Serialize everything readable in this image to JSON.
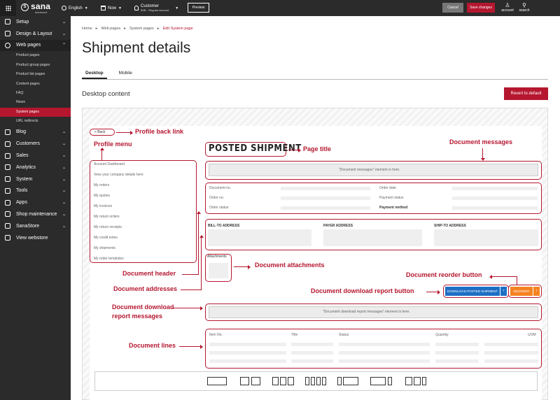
{
  "topbar": {
    "logo_word": "sana",
    "logo_sub": "advanced",
    "language": "English",
    "date": "Now",
    "customer_name": "Customer",
    "customer_sub": "B2B - Regular account",
    "preview": "Preview",
    "cancel": "Cancel",
    "save": "Save changes",
    "account": "account",
    "search": "search"
  },
  "sidebar": {
    "items": [
      {
        "label": "Setup"
      },
      {
        "label": "Design & Layout"
      },
      {
        "label": "Web pages"
      },
      {
        "label": "Blog"
      },
      {
        "label": "Customers"
      },
      {
        "label": "Sales"
      },
      {
        "label": "Analytics"
      },
      {
        "label": "System"
      },
      {
        "label": "Tools"
      },
      {
        "label": "Apps"
      },
      {
        "label": "Shop maintenance"
      },
      {
        "label": "SanaStore"
      },
      {
        "label": "View webstore"
      }
    ],
    "subitems": [
      "Product pages",
      "Product group pages",
      "Product list pages",
      "Content pages",
      "FAQ",
      "News",
      "System pages",
      "URL redirects"
    ]
  },
  "breadcrumb": [
    "Home",
    "Web pages",
    "System pages",
    "Edit System page"
  ],
  "page_title": "Shipment details",
  "tabs": [
    "Desktop",
    "Mobile"
  ],
  "section_title": "Desktop content",
  "revert_label": "Revert to default",
  "preview": {
    "back_label": "< Back",
    "page_title": "POSTED SHIPMENT",
    "profile_menu": [
      "Account Dashboard",
      "View your company details here",
      "My orders",
      "My quotes",
      "My invoices",
      "My return orders",
      "My return receipts",
      "My credit notes",
      "My shipments",
      "My order templates"
    ],
    "messages_placeholder": "\"Document messages\" element is here.",
    "header_fields_left": [
      "Document no.",
      "Order no.",
      "Order status"
    ],
    "header_fields_right": [
      "Order date",
      "Payment status",
      "Payment method"
    ],
    "addresses": [
      "BILL-TO ADDRESS",
      "PAYER ADDRESS",
      "SHIP-TO ADDRESS"
    ],
    "attachments_label": "Attachments",
    "download_button": "DOWNLOAD POSTED SHIPMENT",
    "reorder_button": "REORDER",
    "download_messages_placeholder": "\"Document download report messages\" element is here.",
    "lines_columns": [
      "Item No.",
      "Title",
      "Status",
      "Quantity",
      "UOM"
    ]
  },
  "annotations": {
    "back": "Profile back link",
    "menu": "Profile menu",
    "title": "Page title",
    "messages": "Document messages",
    "attachments": "Document attachments",
    "reorder": "Document reorder button",
    "download": "Document download report button",
    "header": "Document header",
    "addresses": "Document addresses",
    "dl_messages_1": "Document download",
    "dl_messages_2": "report messages",
    "lines": "Document lines"
  }
}
